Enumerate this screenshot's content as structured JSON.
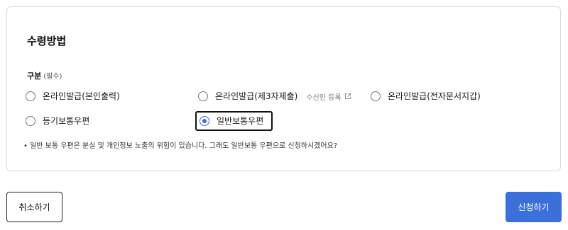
{
  "card": {
    "title": "수령방법",
    "section_label": "구분",
    "required_note": "(필수)"
  },
  "options": [
    {
      "label": "온라인발급(본인출력)",
      "checked": false
    },
    {
      "label": "온라인발급(제3자제출)",
      "checked": false,
      "sub_link": "수신인 등록",
      "sub_icon": "external-link-icon"
    },
    {
      "label": "온라인발급(전자문서지갑)",
      "checked": false
    },
    {
      "label": "등기보통우편",
      "checked": false
    },
    {
      "label": "일반보통우편",
      "checked": true
    }
  ],
  "notice": "• 일반 보통 우편은 분실 및 개인정보 노출의 위험이 있습니다. 그래도 일반보통 우편으로 신청하시겠어요?",
  "buttons": {
    "cancel": "취소하기",
    "submit": "신청하기"
  },
  "colors": {
    "accent": "#3b6fd9",
    "border": "#d9d9d9"
  }
}
